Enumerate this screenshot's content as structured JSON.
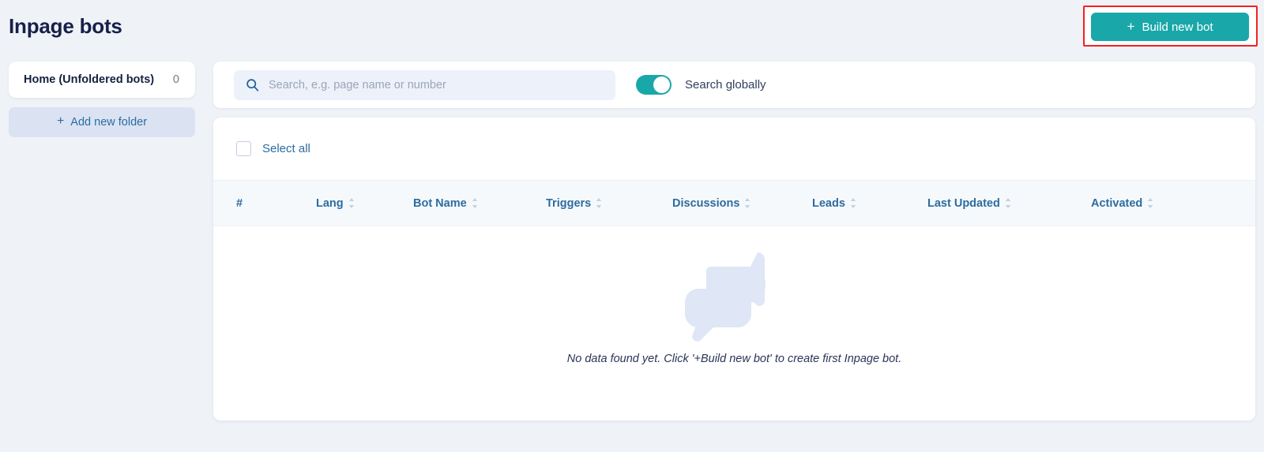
{
  "header": {
    "title": "Inpage bots",
    "build_button": {
      "label": "Build new bot",
      "plus": "+",
      "color": "#1aa7a9"
    },
    "annotation_color": "#f42020"
  },
  "sidebar": {
    "folder": {
      "name": "Home (Unfoldered bots)",
      "count": "0"
    },
    "add_folder": {
      "label": "Add new folder",
      "plus": "+",
      "color": "#2b6ca3"
    }
  },
  "search": {
    "placeholder": "Search, e.g. page name or number",
    "value": "",
    "icon": "search-icon",
    "toggle": {
      "label": "Search globally",
      "state": "on",
      "color": "#1aa7a9"
    }
  },
  "table": {
    "select_all": {
      "label": "Select all",
      "checked": false
    },
    "columns": [
      {
        "label": "#",
        "sortable": false
      },
      {
        "label": "Lang",
        "sortable": true
      },
      {
        "label": "Bot Name",
        "sortable": true
      },
      {
        "label": "Triggers",
        "sortable": true
      },
      {
        "label": "Discussions",
        "sortable": true
      },
      {
        "label": "Leads",
        "sortable": true
      },
      {
        "label": "Last Updated",
        "sortable": true
      },
      {
        "label": "Activated",
        "sortable": true
      }
    ],
    "rows": [],
    "empty_state": {
      "illustration": "chat-bubbles-icon",
      "message": "No data found yet. Click '+Build new bot' to create first Inpage bot."
    }
  }
}
